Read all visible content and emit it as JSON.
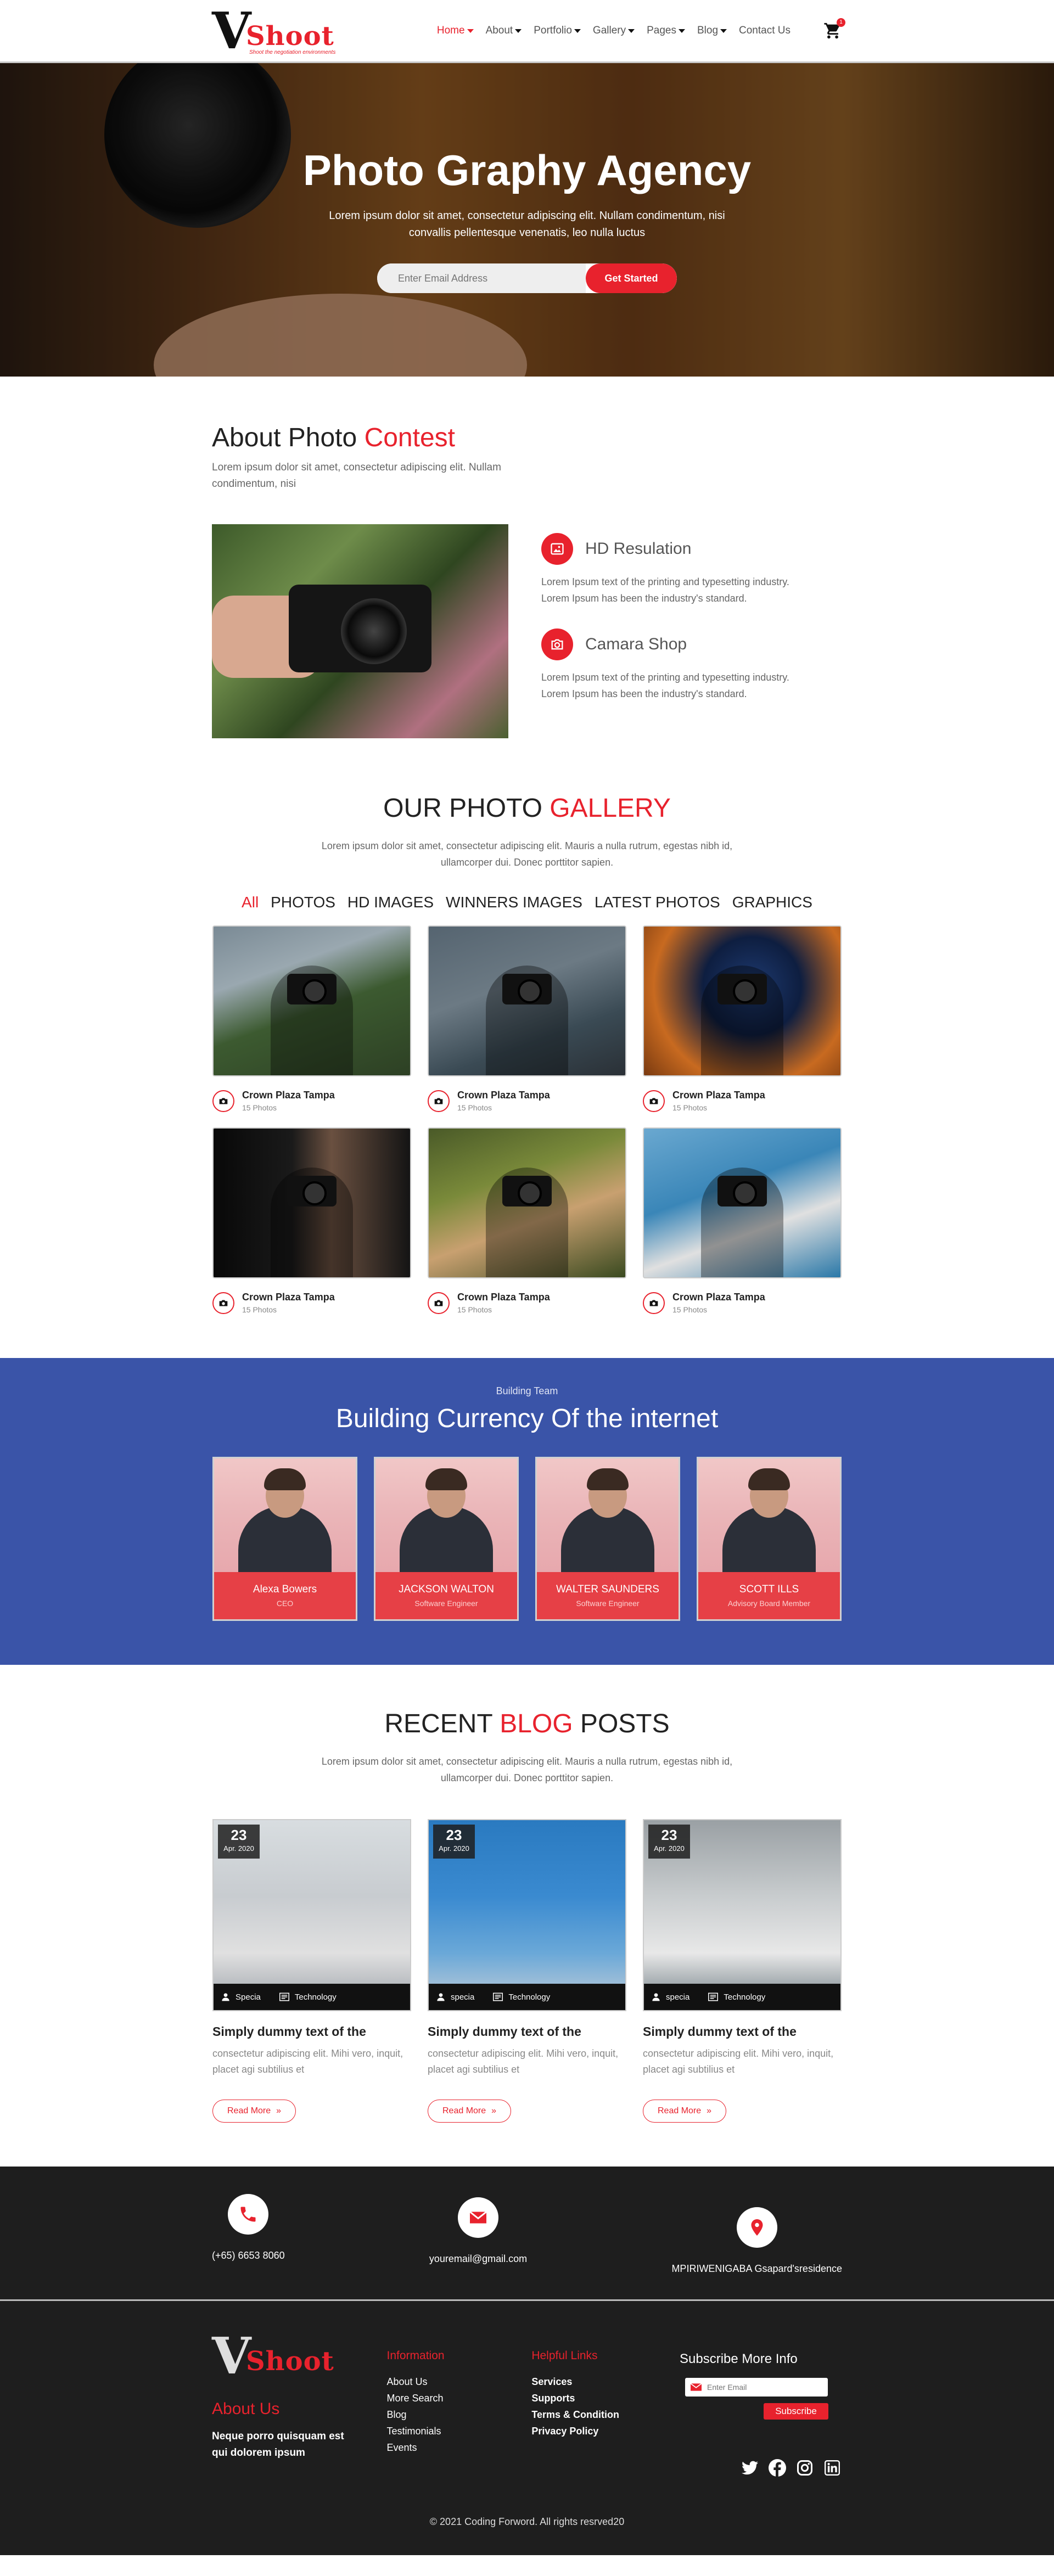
{
  "header": {
    "logo_v": "V",
    "logo_word": "Shoot",
    "logo_tag": "Shoot the negotiation environments",
    "nav": [
      {
        "label": "Home",
        "dropdown": true,
        "active": true
      },
      {
        "label": "About",
        "dropdown": true
      },
      {
        "label": "Portfolio",
        "dropdown": true
      },
      {
        "label": "Gallery",
        "dropdown": true
      },
      {
        "label": "Pages",
        "dropdown": true
      },
      {
        "label": "Blog",
        "dropdown": true
      },
      {
        "label": "Contact Us",
        "dropdown": false
      }
    ],
    "cart_count": "1"
  },
  "hero": {
    "title": "Photo Graphy Agency",
    "text": "Lorem ipsum dolor sit amet, consectetur adipiscing elit. Nullam condimentum, nisi convallis pellentesque venenatis, leo nulla luctus",
    "email_placeholder": "Enter Email Address",
    "cta": "Get Started"
  },
  "about": {
    "title_a": "About Photo",
    "title_b": "Contest",
    "intro": "Lorem ipsum dolor sit amet, consectetur adipiscing elit. Nullam condimentum, nisi",
    "features": [
      {
        "title": "HD Resulation",
        "text": "Lorem Ipsum text of the printing and typesetting industry. Lorem Ipsum has been the industry's standard."
      },
      {
        "title": "Camara Shop",
        "text": "Lorem Ipsum text of the printing and typesetting industry. Lorem Ipsum has been the industry's standard."
      }
    ]
  },
  "gallery": {
    "title_a": "OUR PHOTO",
    "title_b": "GALLERY",
    "sub": "Lorem ipsum dolor sit amet, consectetur adipiscing elit. Mauris a nulla rutrum, egestas nibh id, ullamcorper dui. Donec porttitor sapien.",
    "filters": [
      "All",
      "PHOTOS",
      "HD IMAGES",
      "WINNERS IMAGES",
      "LATEST PHOTOS",
      "GRAPHICS"
    ],
    "items": [
      {
        "name": "Crown Plaza Tampa",
        "count": "15 Photos"
      },
      {
        "name": "Crown Plaza Tampa",
        "count": "15 Photos"
      },
      {
        "name": "Crown Plaza Tampa",
        "count": "15 Photos"
      },
      {
        "name": "Crown Plaza Tampa",
        "count": "15 Photos"
      },
      {
        "name": "Crown Plaza Tampa",
        "count": "15 Photos"
      },
      {
        "name": "Crown Plaza Tampa",
        "count": "15 Photos"
      }
    ]
  },
  "team": {
    "pre": "Building Team",
    "title": "Building Currency Of the internet",
    "members": [
      {
        "name": "Alexa Bowers",
        "role": "CEO"
      },
      {
        "name": "JACKSON WALTON",
        "role": "Software Engineer"
      },
      {
        "name": "WALTER SAUNDERS",
        "role": "Software Engineer"
      },
      {
        "name": "SCOTT ILLS",
        "role": "Advisory Board Member"
      }
    ]
  },
  "blog": {
    "title_a": "RECENT",
    "title_b": "BLOG",
    "title_c": "POSTS",
    "sub": "Lorem ipsum dolor sit amet, consectetur adipiscing elit. Mauris a nulla rutrum, egestas nibh id, ullamcorper dui. Donec porttitor sapien.",
    "posts": [
      {
        "day": "23",
        "month": "Apr. 2020",
        "author": "Specia",
        "cat": "Technology",
        "title": "Simply dummy text of the",
        "text": "consectetur adipiscing elit. Mihi vero, inquit, placet agi subtilius et",
        "btn": "Read More"
      },
      {
        "day": "23",
        "month": "Apr. 2020",
        "author": "specia",
        "cat": "Technology",
        "title": "Simply dummy text of the",
        "text": "consectetur adipiscing elit. Mihi vero, inquit, placet agi subtilius et",
        "btn": "Read More"
      },
      {
        "day": "23",
        "month": "Apr. 2020",
        "author": "specia",
        "cat": "Technology",
        "title": "Simply dummy text of the",
        "text": "consectetur adipiscing elit. Mihi vero, inquit, placet agi subtilius et",
        "btn": "Read More"
      }
    ]
  },
  "contact": {
    "phone": "(+65) 6653 8060",
    "email": "youremail@gmail.com",
    "address": "MPIRIWENIGABA Gsapard'sresidence"
  },
  "footer": {
    "about_title": "About Us",
    "about_text": "Neque porro quisquam est qui dolorem ipsum",
    "info_title": "Information",
    "info_links": [
      "About Us",
      "More Search",
      "Blog",
      "Testimonials",
      "Events"
    ],
    "help_title": "Helpful Links",
    "help_links": [
      "Services",
      "Supports",
      "Terms & Condition",
      "Privacy Policy"
    ],
    "sub_title": "Subscribe More Info",
    "sub_placeholder": "Enter Email",
    "sub_btn": "Subscribe",
    "copyright": "© 2021 Coding Forword. All rights resrved20"
  },
  "colors": {
    "accent": "#e8222d",
    "team_bg": "#3a54a8",
    "dark": "#1e1e1e"
  }
}
